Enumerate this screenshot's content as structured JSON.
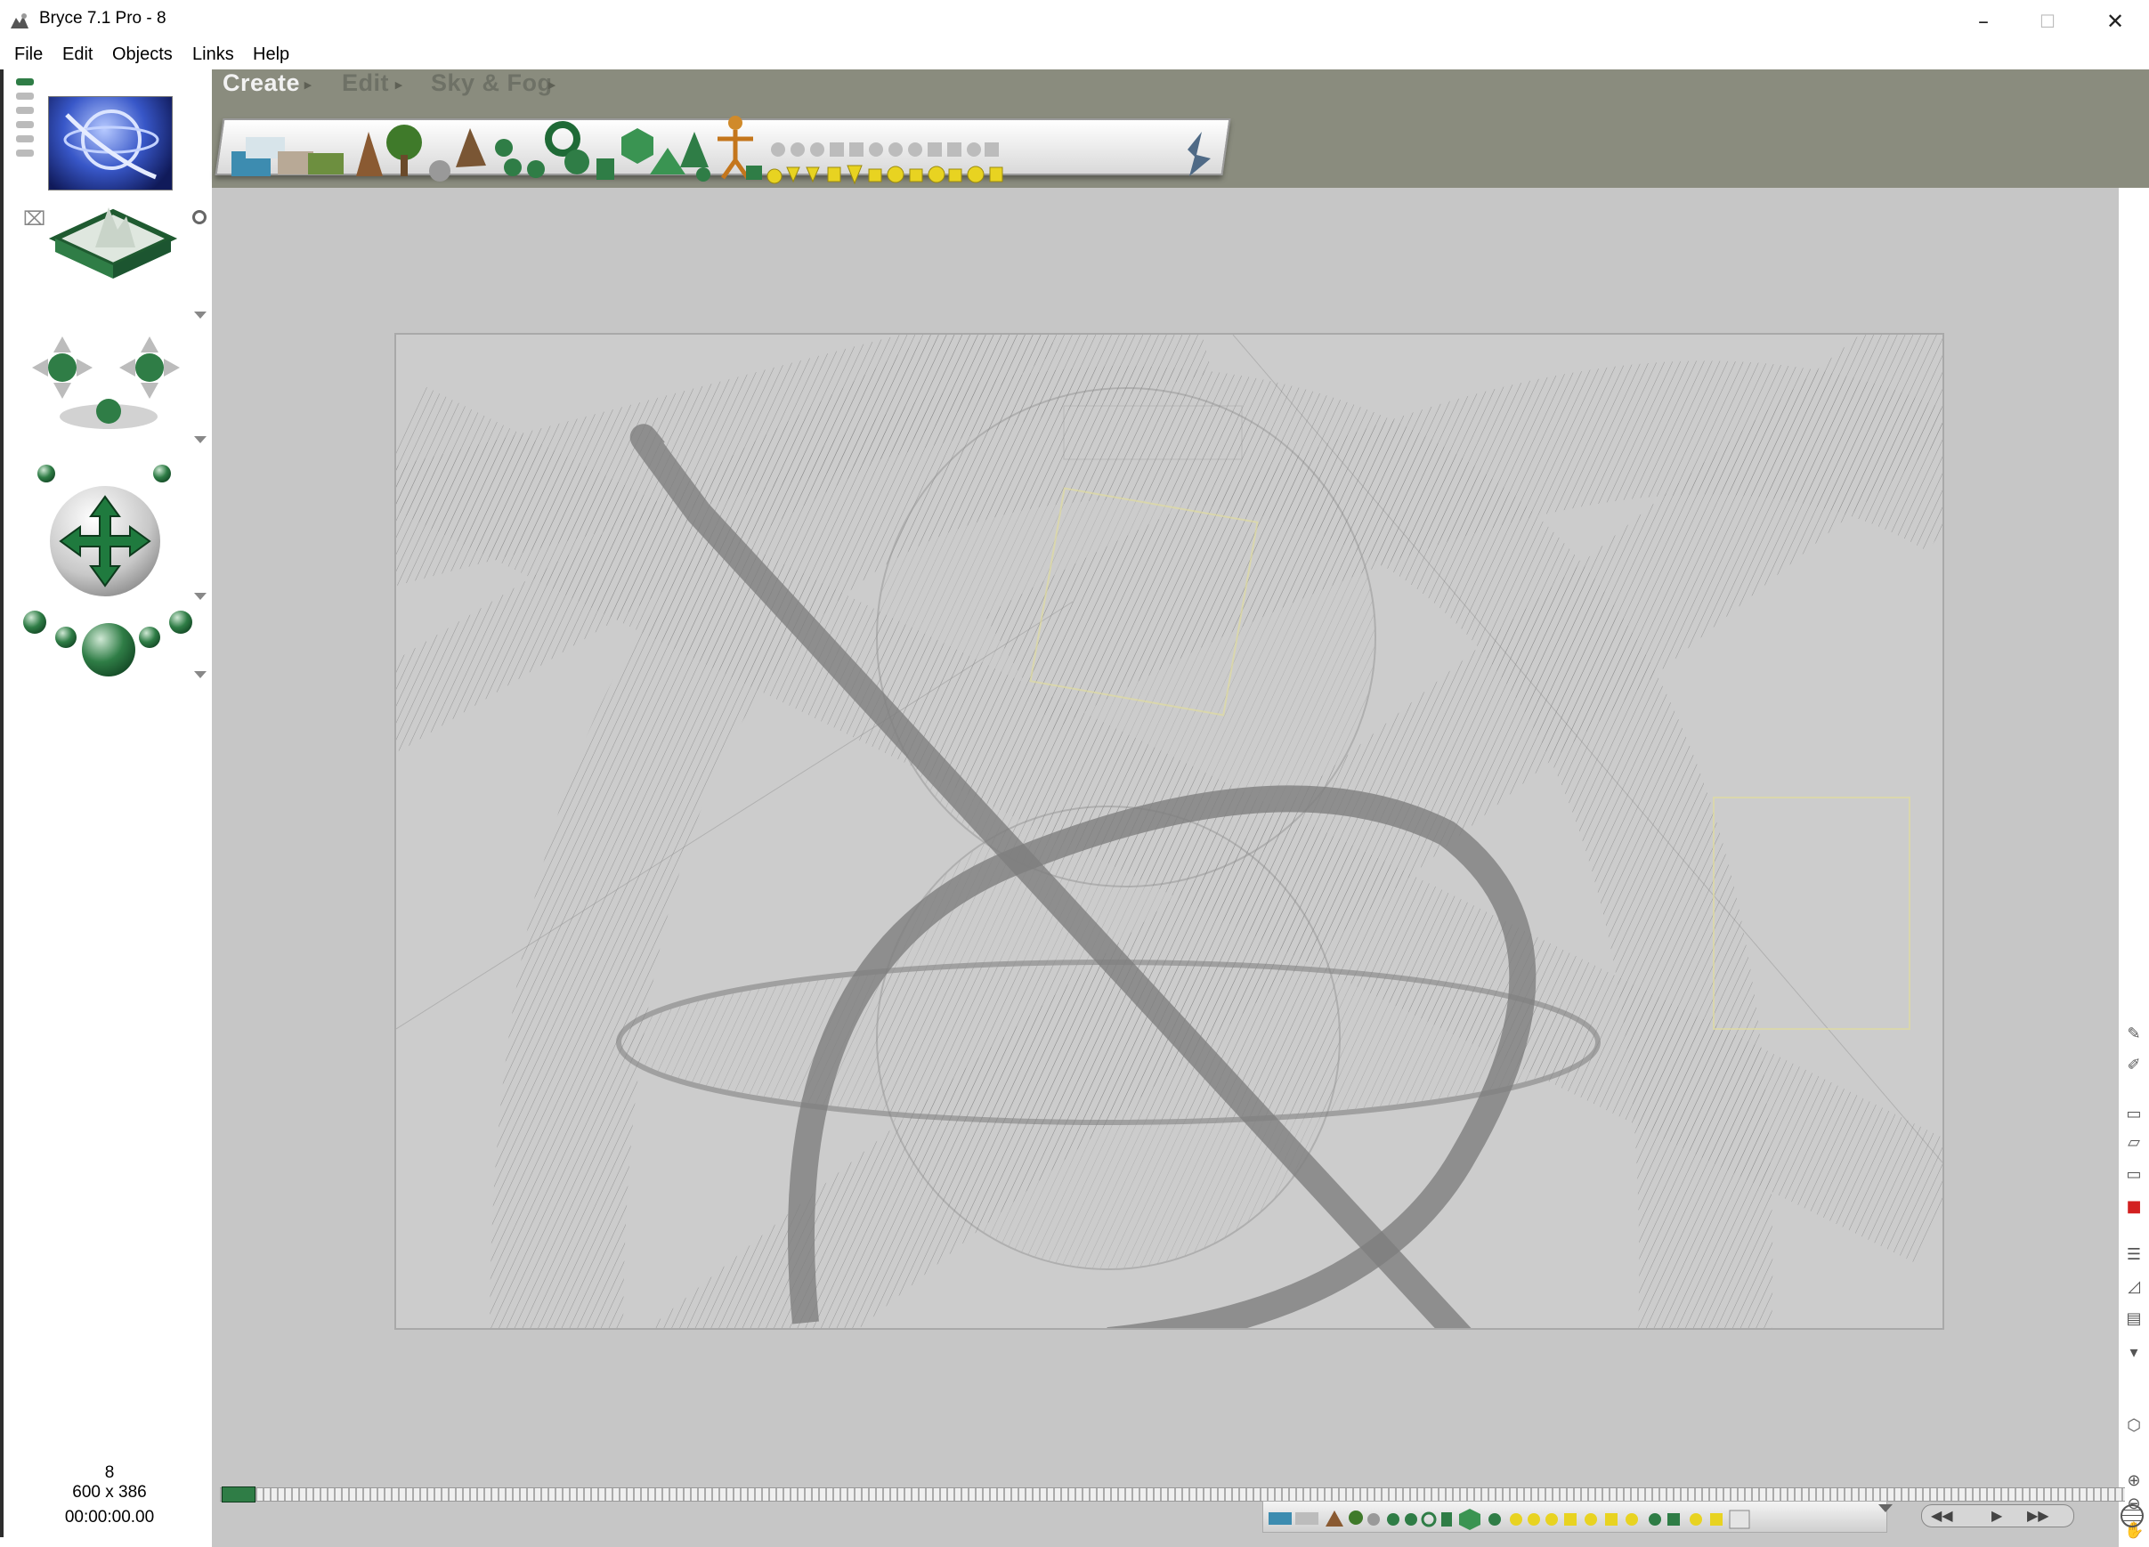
{
  "window": {
    "title": "Bryce 7.1  Pro - 8",
    "minimize_glyph": "–",
    "maximize_glyph": "☐",
    "close_glyph": "✕"
  },
  "menu": {
    "items": [
      "File",
      "Edit",
      "Objects",
      "Links",
      "Help"
    ]
  },
  "palette_tabs": {
    "create": "Create",
    "edit": "Edit",
    "sky_fog": "Sky & Fog"
  },
  "status": {
    "frame": "8",
    "resolution": "600 x 386",
    "time": "00:00:00.00"
  },
  "icons": {
    "app": "bryce-app-icon",
    "right_tools": [
      "pencil-icon",
      "brush-icon",
      "render-icon",
      "view-icon",
      "camera-icon",
      "record-icon",
      "list-icon",
      "scale-icon",
      "bars-icon",
      "monitor-icon",
      "wireframe-icon",
      "zoom-in-icon",
      "zoom-out-icon",
      "hand-icon",
      "globe-icon"
    ]
  },
  "colors": {
    "workspace": "#8a8c7e",
    "canvas": "#c6c6c6",
    "wireframe": "#7a7a7a",
    "accent_green": "#2f7d46",
    "accent_yellow": "#e8d321"
  }
}
